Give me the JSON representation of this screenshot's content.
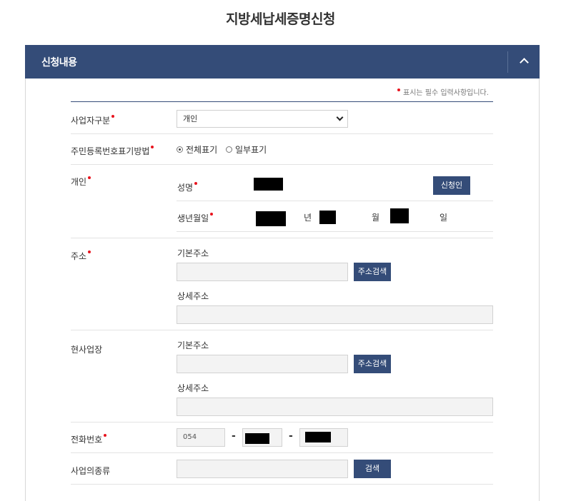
{
  "page": {
    "title": "지방세납세증명신청"
  },
  "panel": {
    "title": "신청내용",
    "toggle_icon": "chevron-up-icon"
  },
  "notice": "표시는 필수 입력사항입니다.",
  "fields": {
    "business_type": {
      "label": "사업자구분",
      "value": "개인"
    },
    "rrn_display": {
      "label": "주민등록번호표기방법",
      "option_full": "전체표기",
      "option_partial": "일부표기",
      "selected": "전체표기"
    },
    "individual": {
      "label": "개인",
      "name_label": "성명",
      "applicant_button": "신청인",
      "birth_label": "생년월일",
      "year_unit": "년",
      "month_unit": "월",
      "day_unit": "일"
    },
    "address": {
      "label": "주소",
      "basic_label": "기본주소",
      "search_button": "주소검색",
      "detail_label": "상세주소"
    },
    "workplace": {
      "label": "현사업장",
      "basic_label": "기본주소",
      "search_button": "주소검색",
      "detail_label": "상세주소"
    },
    "phone": {
      "label": "전화번호",
      "area_code": "054",
      "separator": "-"
    },
    "business_kind": {
      "label": "사업의종류",
      "search_button": "검색"
    }
  },
  "colors": {
    "accent": "#344c78",
    "required": "#e8141e"
  }
}
